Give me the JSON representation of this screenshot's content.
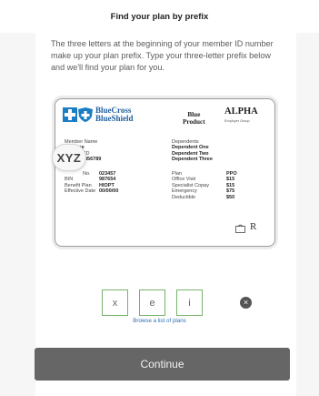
{
  "header": {
    "title": "Find your plan by prefix"
  },
  "intro": "The three letters at the beginning of your member ID number make up your plan prefix. Type your three-letter prefix below and we'll find your plan for you.",
  "card": {
    "brand_line1": "BlueCross",
    "brand_line2": "BlueShield",
    "product_line1": "Blue",
    "product_line2": "Product",
    "alpha": "ALPHA",
    "employer": "Employer Group",
    "member_name_label": "Member Name",
    "member_name": "er Name",
    "id_label": "ID",
    "id_value": "456789",
    "dependents_label": "Dependents",
    "dependents": [
      "Dependent One",
      "Dependent Two",
      "Dependent Three"
    ],
    "rx_labels": [
      "No.",
      "BIN",
      "Benefit Plan",
      "Effective Date"
    ],
    "rx_values": [
      "023457",
      "987654",
      "HIOPT",
      "00/00/00"
    ],
    "plan_labels": [
      "Plan",
      "Office Visit",
      "Specialist Copay",
      "Emergency",
      "Deductible"
    ],
    "plan_values": [
      "PPO",
      "$15",
      "$15",
      "$75",
      "$50"
    ],
    "prefix_highlight": "XYZ",
    "rx_symbol": "R"
  },
  "prefix": {
    "letters": [
      "x",
      "e",
      "i"
    ],
    "clear_icon": "×"
  },
  "browse_link": "Browse a list of plans",
  "continue_label": "Continue",
  "colors": {
    "box_border": "#78b26d",
    "button_bg": "#666666",
    "link": "#2e6fb0",
    "brand_blue": "#1b7ec4"
  },
  "icons": [
    "cross-icon",
    "shield-icon",
    "pharmacy-icon",
    "rx-icon",
    "clear-icon"
  ]
}
